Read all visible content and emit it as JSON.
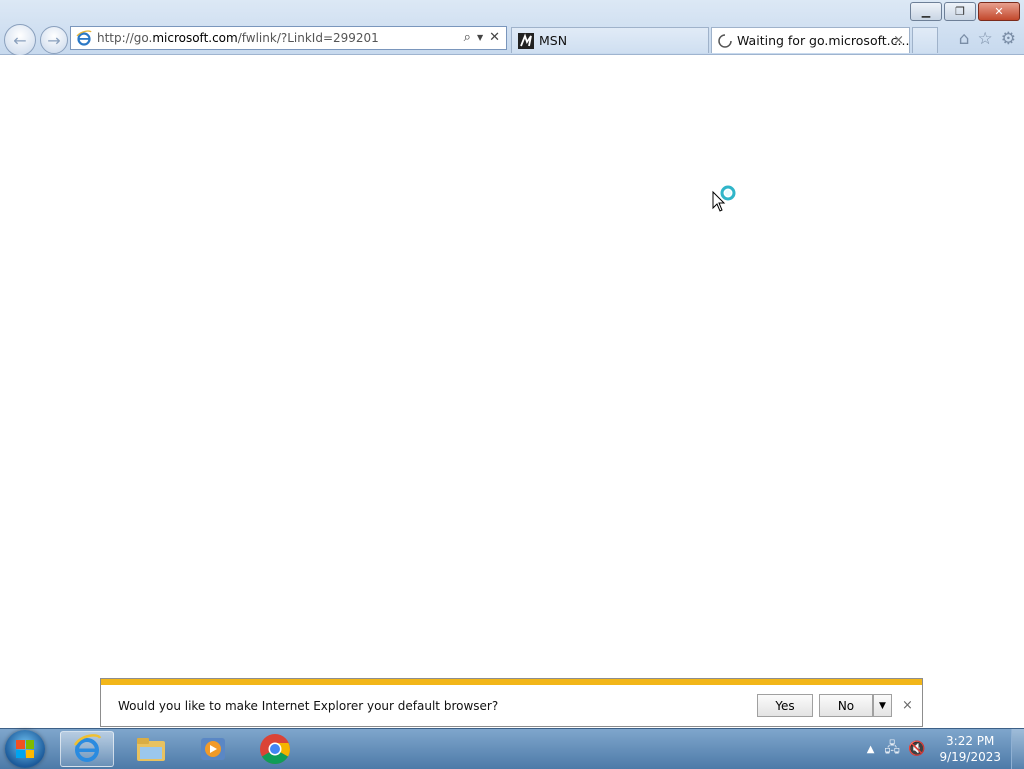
{
  "browser": {
    "address": {
      "url_prefix": "http://go.",
      "url_domain": "microsoft.com",
      "url_path": "/fwlink/?LinkId=299201"
    },
    "tabs": [
      {
        "label": "MSN",
        "icon": "msn-icon"
      },
      {
        "label": "Waiting for go.microsoft.c...",
        "icon": "loading-spinner-icon",
        "close": "×"
      }
    ],
    "command_icons": [
      "home-icon",
      "favorites-star-icon",
      "settings-gear-icon"
    ]
  },
  "notification": {
    "message": "Would you like to make Internet Explorer your default browser?",
    "yes_label": "Yes",
    "no_label": "No",
    "close": "×"
  },
  "taskbar": {
    "apps": [
      "internet-explorer",
      "windows-explorer",
      "windows-media-player",
      "google-chrome"
    ],
    "clock_time": "3:22 PM",
    "clock_date": "9/19/2023"
  },
  "colors": {
    "notification_accent": "#f2b619",
    "frame": "#c7d9ee",
    "taskbar": "#4d7aa8"
  }
}
